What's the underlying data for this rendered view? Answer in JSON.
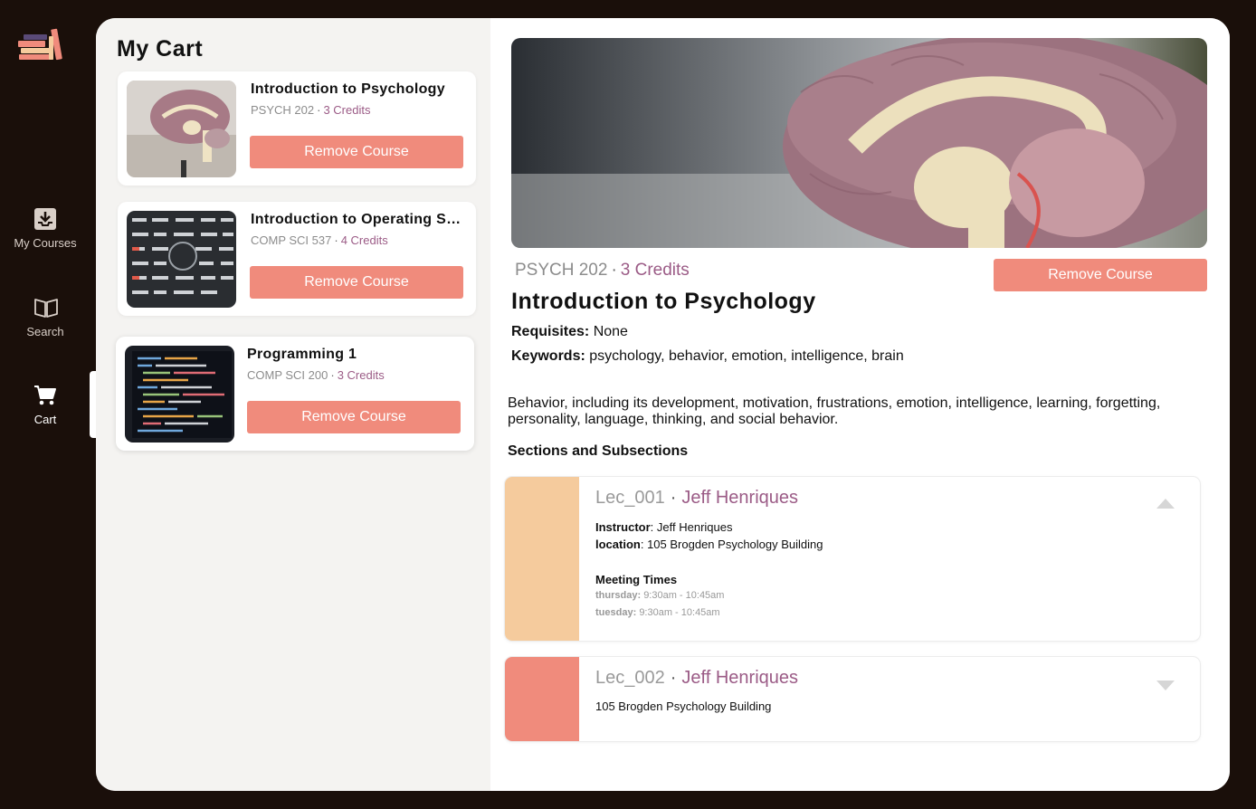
{
  "nav": {
    "items": [
      {
        "label": "My Courses",
        "icon": "download-tray-icon"
      },
      {
        "label": "Search",
        "icon": "open-book-icon"
      },
      {
        "label": "Cart",
        "icon": "cart-icon",
        "active": true
      }
    ]
  },
  "cart": {
    "title": "My Cart",
    "items": [
      {
        "title": "Introduction to Psychology",
        "code": "PSYCH 202",
        "credits": "3 Credits",
        "button": "Remove Course",
        "image": "brain-model"
      },
      {
        "title": "Introduction to Operating Systems",
        "code": "COMP SCI 537",
        "credits": "4 Credits",
        "button": "Remove Course",
        "image": "server-rack"
      },
      {
        "title": "Programming 1",
        "code": "COMP SCI 200",
        "credits": "3 Credits",
        "button": "Remove Course",
        "image": "code-screen"
      }
    ]
  },
  "detail": {
    "code": "PSYCH 202",
    "credits": "3 Credits",
    "remove_label": "Remove Course",
    "title": "Introduction to Psychology",
    "requisites_label": "Requisites:",
    "requisites_value": "None",
    "keywords_label": "Keywords:",
    "keywords_value": "psychology, behavior, emotion, intelligence, brain",
    "description": "Behavior, including its development, motivation, frustrations, emotion, intelligence, learning, forgetting, personality, language, thinking, and social behavior.",
    "sections_heading": "Sections and Subsections",
    "sections": [
      {
        "name": "Lec_001",
        "instructor_name": "Jeff Henriques",
        "instructor_label": "Instructor",
        "location_label": "location",
        "location": "105 Brogden Psychology Building",
        "meeting_heading": "Meeting Times",
        "times": [
          {
            "day": "thursday:",
            "time": "9:30am - 10:45am"
          },
          {
            "day": "tuesday:",
            "time": "9:30am - 10:45am"
          }
        ],
        "color": "#f5cb9d",
        "expanded": true
      },
      {
        "name": "Lec_002",
        "instructor_name": "Jeff Henriques",
        "location": "105 Brogden Psychology Building",
        "color": "#f08b7c",
        "expanded": false
      }
    ]
  },
  "colors": {
    "accent": "#f08b7c",
    "credits": "#9b5b86",
    "background": "#1a0f0a"
  }
}
